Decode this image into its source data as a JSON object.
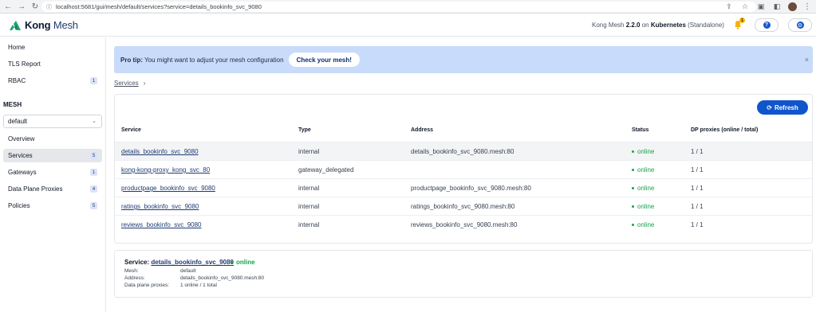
{
  "browser": {
    "url": "localhost:5681/gui/mesh/default/services?service=details_bookinfo_svc_9080",
    "back_icon": "arrow-left-icon",
    "forward_icon": "arrow-right-icon",
    "reload_icon": "reload-icon"
  },
  "header": {
    "logo_bold": "Kong",
    "logo_light": "Mesh",
    "version_prefix": "Kong Mesh",
    "version": "2.2.0",
    "on": "on",
    "platform": "Kubernetes",
    "mode": "(Standalone)",
    "notification_count": "1",
    "help_glyph": "?",
    "settings_glyph": "⚙"
  },
  "sidebar": {
    "top_items": [
      {
        "label": "Home",
        "badge": ""
      },
      {
        "label": "TLS Report",
        "badge": ""
      },
      {
        "label": "RBAC",
        "badge": "1"
      }
    ],
    "mesh_heading": "MESH",
    "mesh_select": "default",
    "mesh_items": [
      {
        "label": "Overview",
        "badge": ""
      },
      {
        "label": "Services",
        "badge": "5"
      },
      {
        "label": "Gateways",
        "badge": "1"
      },
      {
        "label": "Data Plane Proxies",
        "badge": "4"
      },
      {
        "label": "Policies",
        "badge": "5"
      }
    ]
  },
  "tip": {
    "prefix": "Pro tip:",
    "text": "You might want to adjust your mesh configuration",
    "button": "Check your mesh!",
    "close": "×"
  },
  "breadcrumb": {
    "item": "Services",
    "separator": "›"
  },
  "table": {
    "refresh_label": "Refresh",
    "headers": {
      "service": "Service",
      "type": "Type",
      "address": "Address",
      "status": "Status",
      "dp": "DP proxies (online / total)"
    },
    "rows": [
      {
        "service": "details_bookinfo_svc_9080",
        "type": "internal",
        "address": "details_bookinfo_svc_9080.mesh:80",
        "status": "online",
        "dp": "1 / 1"
      },
      {
        "service": "kong-kong-proxy_kong_svc_80",
        "type": "gateway_delegated",
        "address": "",
        "status": "online",
        "dp": "1 / 1"
      },
      {
        "service": "productpage_bookinfo_svc_9080",
        "type": "internal",
        "address": "productpage_bookinfo_svc_9080.mesh:80",
        "status": "online",
        "dp": "1 / 1"
      },
      {
        "service": "ratings_bookinfo_svc_9080",
        "type": "internal",
        "address": "ratings_bookinfo_svc_9080.mesh:80",
        "status": "online",
        "dp": "1 / 1"
      },
      {
        "service": "reviews_bookinfo_svc_9080",
        "type": "internal",
        "address": "reviews_bookinfo_svc_9080.mesh:80",
        "status": "online",
        "dp": "1 / 1"
      }
    ]
  },
  "detail": {
    "title_prefix": "Service:",
    "service": "details_bookinfo_svc_9080",
    "status": "online",
    "mesh_label": "Mesh:",
    "mesh_value": "default",
    "address_label": "Address:",
    "address_value": "details_bookinfo_svc_9080.mesh:80",
    "dp_label": "Data plane proxies:",
    "dp_value": "1 online / 1 total"
  },
  "colors": {
    "accent": "#1155cb",
    "tip_bg": "#c8dbfa",
    "online": "#16a34a"
  }
}
